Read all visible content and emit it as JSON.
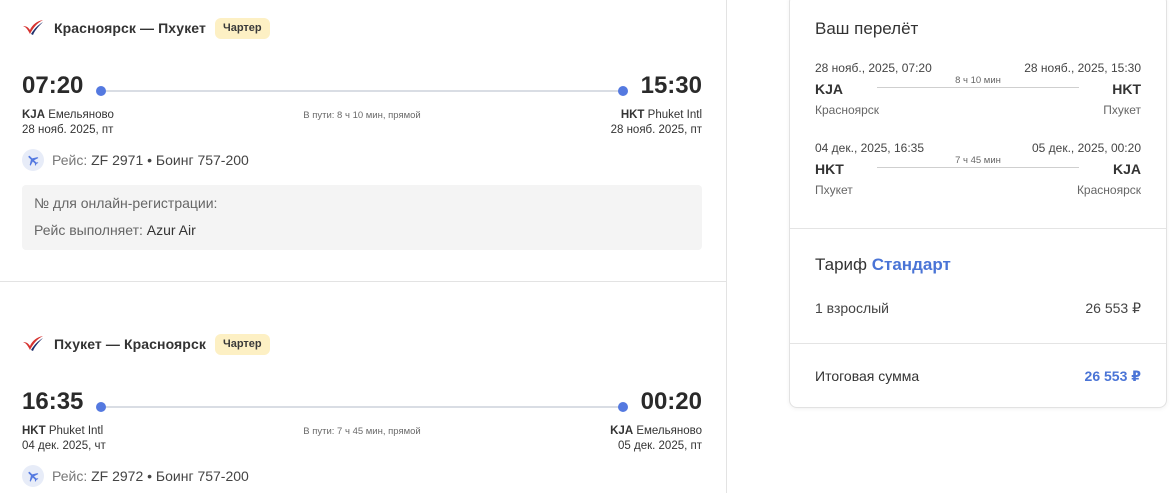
{
  "legs": [
    {
      "route": "Красноярск — Пхукет",
      "badge": "Чартер",
      "dep_time": "07:20",
      "arr_time": "15:30",
      "dep_code": "KJA",
      "dep_airport": "Емельяново",
      "dep_date": "28 нояб. 2025, пт",
      "arr_code": "HKT",
      "arr_airport": "Phuket Intl",
      "arr_date": "28 нояб. 2025, пт",
      "duration": "В пути: 8 ч 10 мин, прямой",
      "flight_label": "Рейс:",
      "flight_value": "ZF 2971 • Боинг 757-200",
      "checkin_label": "№ для онлайн-регистрации:",
      "operator_label": "Рейс выполняет:",
      "operator_value": "Azur Air"
    },
    {
      "route": "Пхукет — Красноярск",
      "badge": "Чартер",
      "dep_time": "16:35",
      "arr_time": "00:20",
      "dep_code": "HKT",
      "dep_airport": "Phuket Intl",
      "dep_date": "04 дек. 2025, чт",
      "arr_code": "KJA",
      "arr_airport": "Емельяново",
      "arr_date": "05 дек. 2025, пт",
      "duration": "В пути: 7 ч 45 мин, прямой",
      "flight_label": "Рейс:",
      "flight_value": "ZF 2972 • Боинг 757-200"
    }
  ],
  "summary": {
    "title": "Ваш перелёт",
    "segments": [
      {
        "dep_datetime": "28 нояб., 2025, 07:20",
        "arr_datetime": "28 нояб., 2025, 15:30",
        "duration": "8 ч 10 мин",
        "dep_code": "KJA",
        "arr_code": "HKT",
        "dep_city": "Красноярск",
        "arr_city": "Пхукет"
      },
      {
        "dep_datetime": "04 дек., 2025, 16:35",
        "arr_datetime": "05 дек., 2025, 00:20",
        "duration": "7 ч 45 мин",
        "dep_code": "HKT",
        "arr_code": "KJA",
        "dep_city": "Пхукет",
        "arr_city": "Красноярск"
      }
    ],
    "tariff_label": "Тариф",
    "tariff_name": "Стандарт",
    "pax_label": "1 взрослый",
    "pax_price": "26 553 ₽",
    "total_label": "Итоговая сумма",
    "total_price": "26 553 ₽"
  },
  "colors": {
    "accent": "#5479e0",
    "link": "#4a74d6",
    "badge_bg": "#fdf0c4",
    "logo_red": "#d6322f",
    "logo_navy": "#1f2f6b"
  },
  "icons": {
    "airline_logo": "airline-wing-logo-icon",
    "plane": "airplane-icon"
  }
}
